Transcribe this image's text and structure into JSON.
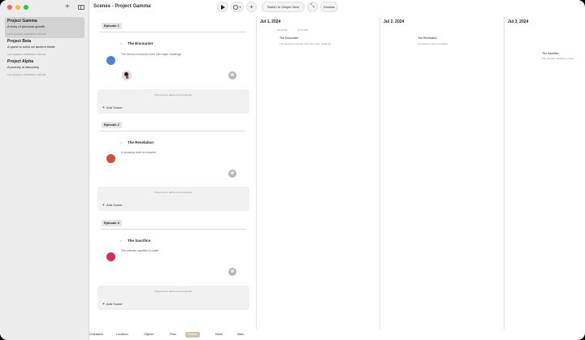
{
  "window": {
    "title": "Scenes - Project Gamma"
  },
  "sidebar": {
    "projects": [
      {
        "name": "Project Gamma",
        "desc": "A story of personal growth",
        "updated": "Last Updated: 12/08/2024, 3:40 AM"
      },
      {
        "name": "Project Beta",
        "desc": "A quest to solve an ancient riddle",
        "updated": "Last Updated: 12/08/2024, 3:40 AM"
      },
      {
        "name": "Project Alpha",
        "desc": "A journey of discovery",
        "updated": "Last Updated: 12/08/2024, 3:40 AM"
      }
    ]
  },
  "toolbar": {
    "simple_view": "Switch to Simple View",
    "dismiss": "Dismiss"
  },
  "episodes": [
    {
      "label": "Episode 1",
      "scene_title": "The Encounter",
      "scene_desc": "The heroes encounter their first major challenge",
      "dot_color": "#4a86d4",
      "drop_hint": "Drop here to add to end of episode",
      "add_label": "Add Scene"
    },
    {
      "label": "Episode 2",
      "scene_title": "The Revelation",
      "scene_desc": "A shocking truth is revealed",
      "dot_color": "#d24e34",
      "drop_hint": "Drop here to add to end of episode",
      "add_label": "Add Scene"
    },
    {
      "label": "Episode 3",
      "scene_title": "The Sacrifice",
      "scene_desc": "The ultimate sacrifice is made",
      "dot_color": "#d42e52",
      "drop_hint": "Drop here to add to end of episode",
      "add_label": "Add Scene"
    }
  ],
  "timeline": {
    "dates": [
      "Jul 1, 2024",
      "Jul 2, 2024",
      "Jul 3, 2024"
    ],
    "events": [
      {
        "start": "10:00 AM",
        "end": "12:00 PM",
        "title": "The Encounter",
        "desc": "The heroes encounter their first major challenge"
      },
      {
        "start": "",
        "end": "",
        "title": "The Revelation",
        "desc": "A shocking truth is revealed"
      },
      {
        "start": "",
        "end": "",
        "title": "The Sacrifice",
        "desc": "The ultimate sacrifice is made"
      }
    ]
  },
  "tabs": {
    "items": [
      "Characters",
      "Locations",
      "Objects",
      "Plots",
      "Scenes",
      "Notes",
      "Stats"
    ],
    "selected": "Scenes"
  }
}
